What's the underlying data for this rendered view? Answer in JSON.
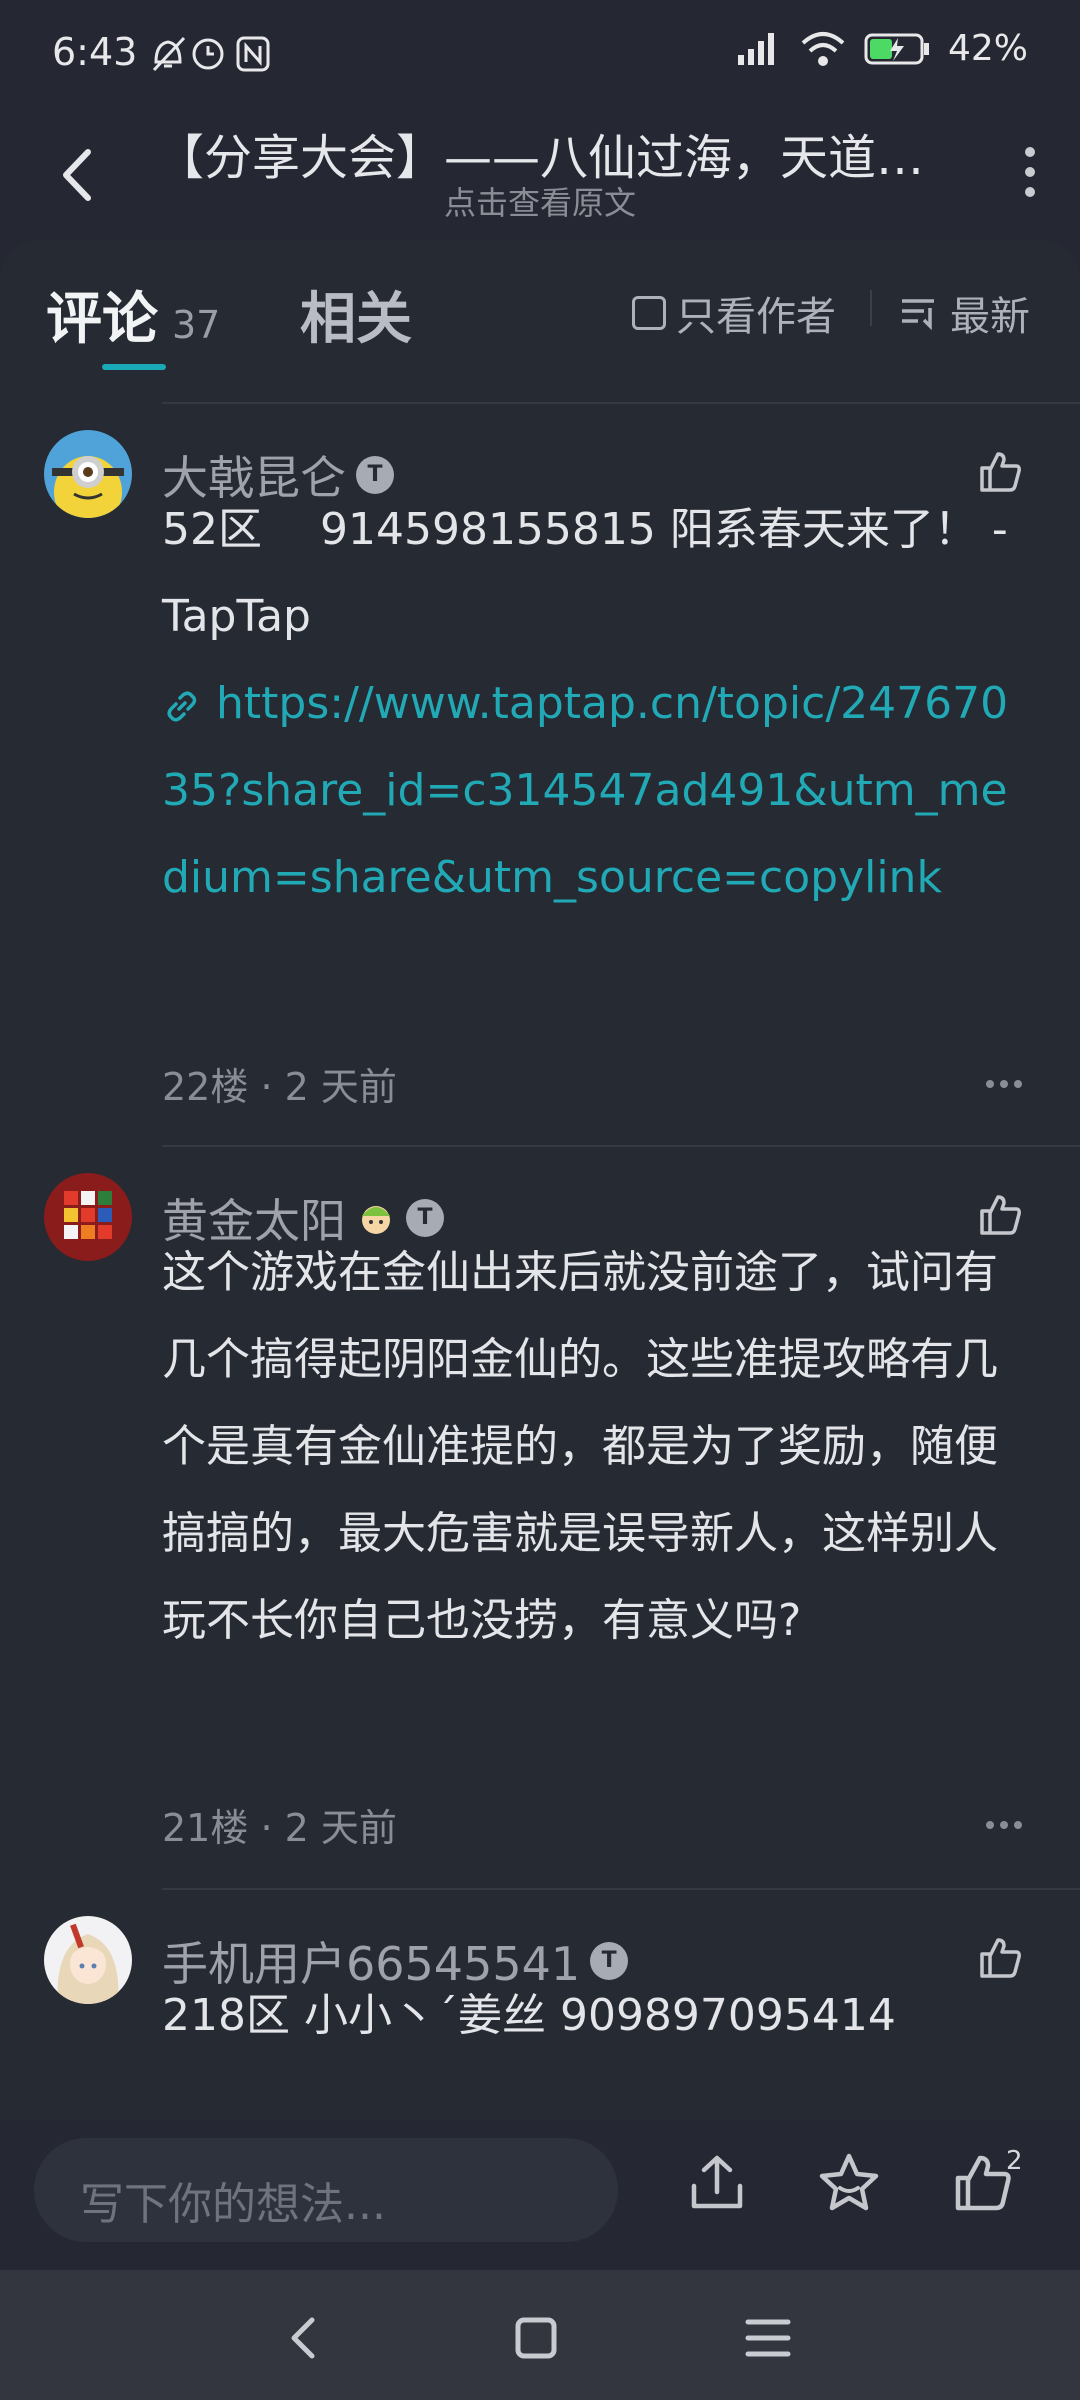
{
  "status_bar": {
    "time": "6:43",
    "battery": "42%"
  },
  "header": {
    "title": "【分享大会】——八仙过海，天道…",
    "subtitle": "点击查看原文"
  },
  "tabs": {
    "comments_label": "评论",
    "comments_count": "37",
    "related_label": "相关",
    "only_author": "只看作者",
    "sort": "最新"
  },
  "comments": [
    {
      "user": "大戟昆仑",
      "body_text": "52区　 914598155815  阳系春天来了！ - TapTap",
      "link": "https://www.taptap.cn/topic/24767035?share_id=c314547ad491&utm_medium=share&utm_source=copylink",
      "floor": "22楼",
      "time": "2 天前"
    },
    {
      "user": "黄金太阳",
      "body_text": "这个游戏在金仙出来后就没前途了，试问有几个搞得起阴阳金仙的。这些准提攻略有几个是真有金仙准提的，都是为了奖励，随便搞搞的，最大危害就是误导新人，这样别人玩不长你自己也没捞，有意义吗?",
      "floor": "21楼",
      "time": "2 天前"
    },
    {
      "user": "手机用户66545541",
      "body_text": "218区 小小丶ˊ姜丝 909897095414"
    }
  ],
  "bottom_bar": {
    "placeholder": "写下你的想法...",
    "like_count": "2"
  },
  "colors": {
    "background": "#252832",
    "accent": "#1aa9b6",
    "link": "#21a9b5",
    "text": "#e4e5e9",
    "muted": "#8a8d96"
  }
}
